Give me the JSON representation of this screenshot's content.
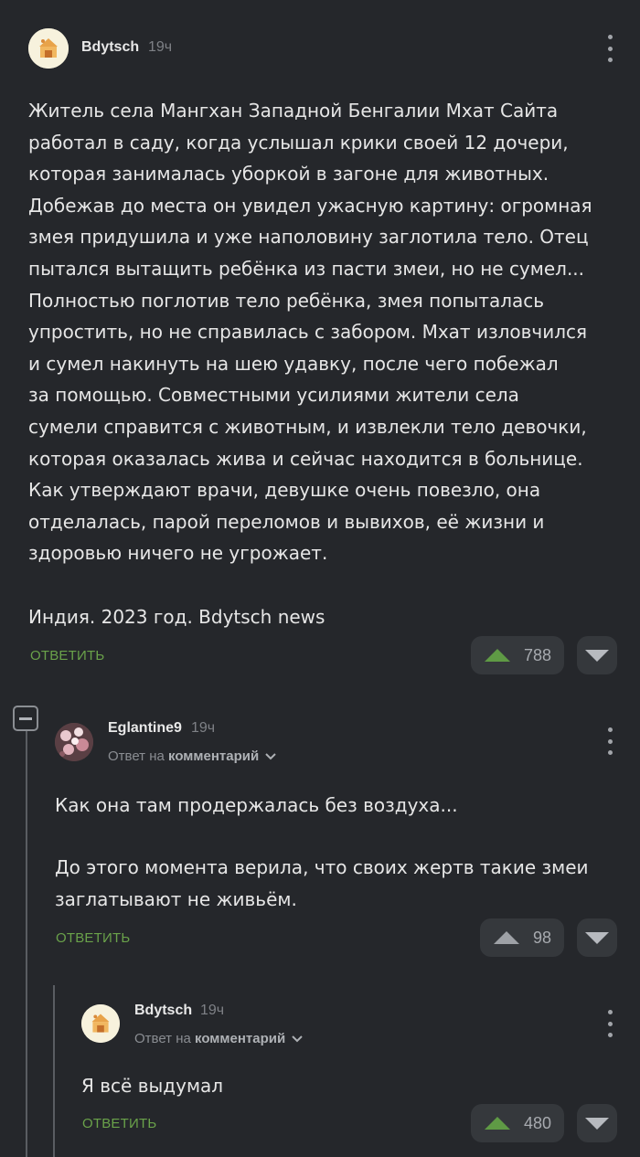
{
  "comment_main": {
    "author": "Bdytsch",
    "time": "19ч",
    "lines": [
      "Житель села Мангхан Западной Бенгалии Мхат Сайта",
      "работал в саду, когда услышал крики своей 12 дочери,",
      "которая занималась уборкой в загоне для животных.",
      "Добежав до места он увидел ужасную картину: огромная",
      "змея придушила и уже наполовину заглотила тело. Отец",
      "пытался вытащить ребёнка из пасти змеи, но не сумел...",
      "Полностью поглотив тело ребёнка, змея попыталась",
      "упростить, но не справилась с забором. Мхат изловчился",
      "и сумел накинуть на шею удавку, после чего побежал",
      "за помощью. Совместными усилиями жители села",
      "сумели справится с животным, и извлекли тело девочки,",
      "которая оказалась жива и сейчас находится в больнице.",
      "Как утверждают врачи, девушке очень повезло, она",
      "отделалась, парой переломов и вывихов, её жизни и",
      "здоровью ничего не угрожает."
    ],
    "footer_line": "Индия. 2023 год. Bdytsch news",
    "reply_label": "ОТВЕТИТЬ",
    "rating": "788",
    "avatar_icon": "hamster-house-icon"
  },
  "comment_reply1": {
    "author": "Eglantine9",
    "time": "19ч",
    "reply_to_prefix": "Ответ на",
    "reply_to_target": "комментарий",
    "lines": [
      "Как она там продержалась без воздуха..."
    ],
    "lines2": [
      "До этого момента верила, что своих жертв такие змеи",
      "заглатывают не живьём."
    ],
    "reply_label": "ОТВЕТИТЬ",
    "rating": "98",
    "avatar_icon": "flower-photo-icon"
  },
  "comment_reply2": {
    "author": "Bdytsch",
    "time": "19ч",
    "reply_to_prefix": "Ответ на",
    "reply_to_target": "комментарий",
    "text": "Я всё выдумал",
    "reply_label": "ОТВЕТИТЬ",
    "rating": "480",
    "avatar_icon": "hamster-house-icon"
  },
  "colors": {
    "background": "#25272b",
    "reply_green": "#6aa24a",
    "upvote_green": "#5f9a45",
    "vote_bg": "#35383c"
  }
}
